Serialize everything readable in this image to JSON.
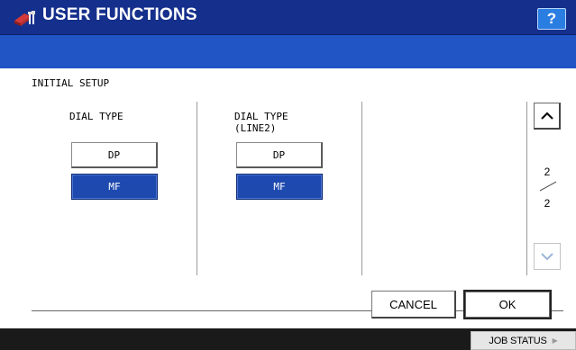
{
  "header": {
    "title": "USER FUNCTIONS",
    "icon": "user-functions-icon",
    "help_label": "?"
  },
  "section": {
    "title": "INITIAL SETUP"
  },
  "columns": [
    {
      "label": "DIAL TYPE",
      "options": [
        {
          "label": "DP",
          "selected": false
        },
        {
          "label": "MF",
          "selected": true
        }
      ]
    },
    {
      "label": "DIAL TYPE\n(LINE2)",
      "label_line1": "DIAL TYPE",
      "label_line2": "(LINE2)",
      "options": [
        {
          "label": "DP",
          "selected": false
        },
        {
          "label": "MF",
          "selected": true
        }
      ]
    }
  ],
  "pagination": {
    "current": "2",
    "total": "2",
    "up_icon": "chevron-up-icon",
    "down_icon": "chevron-down-icon"
  },
  "actions": {
    "cancel_label": "CANCEL",
    "ok_label": "OK"
  },
  "footer": {
    "job_status_label": "JOB STATUS"
  },
  "colors": {
    "titlebar": "#152f8c",
    "subbar": "#2154c4",
    "selected_button": "#1e4ab0",
    "help_button": "#2a7de1",
    "footer": "#1a1a1a"
  }
}
